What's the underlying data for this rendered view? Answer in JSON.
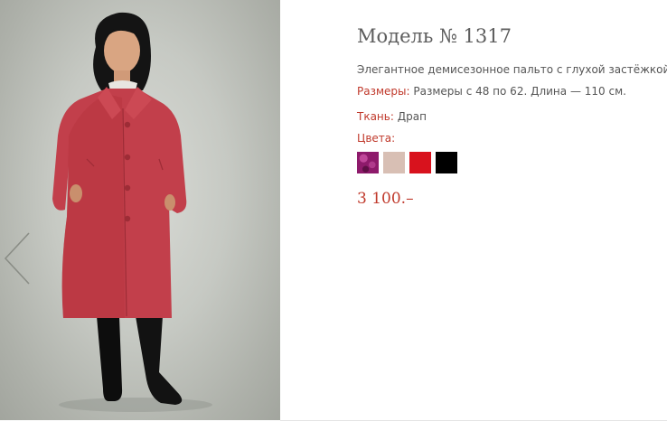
{
  "product": {
    "title": "Модель № 1317",
    "description": "Элегантное демисезонное пальто с глухой застёжкой.",
    "sizes_label": "Размеры:",
    "sizes_value": "Размеры с 48 по 62. Длина — 110 см.",
    "fabric_label": "Ткань:",
    "fabric_value": "Драп",
    "colors_label": "Цвета:",
    "colors": [
      {
        "name": "purple-pattern",
        "hex": "#8e1a6b"
      },
      {
        "name": "beige",
        "hex": "#d8bfb4"
      },
      {
        "name": "red",
        "hex": "#d8121d"
      },
      {
        "name": "black",
        "hex": "#000000"
      }
    ],
    "price": "3 100.–"
  },
  "gallery": {
    "prev_icon": "chevron-left-icon"
  },
  "theme": {
    "accent": "#c0392b",
    "text": "#555555",
    "title": "#5d5d5d"
  }
}
